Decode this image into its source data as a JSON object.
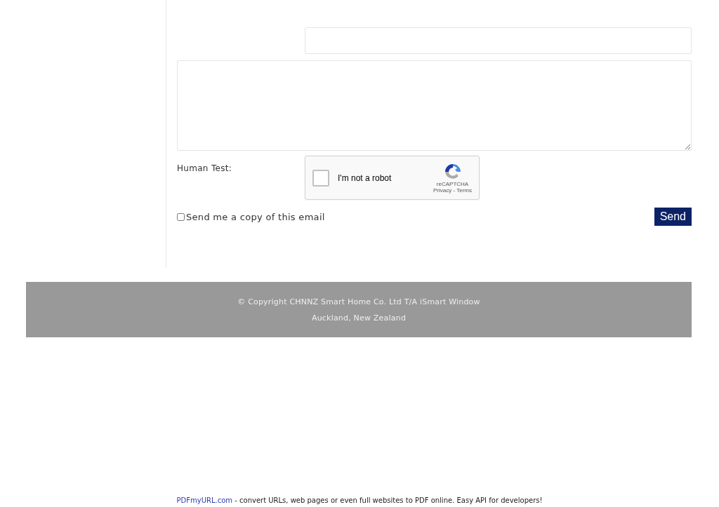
{
  "form": {
    "human_test": {
      "label": "Human Test:",
      "captcha": {
        "checked": false,
        "label": "I'm not a robot",
        "brand": "reCAPTCHA",
        "links": "Privacy - Terms"
      }
    },
    "copy_option": {
      "checked": false,
      "label": "Send me a copy of this email"
    },
    "send_button": "Send"
  },
  "footer": {
    "lines": [
      "© Copyright CHNNZ Smart Home Co. Ltd T/A iSmart Window",
      "Auckland, New Zealand"
    ]
  },
  "pdf_banner": {
    "link": "PDFmyURL.com",
    "text": " - convert URLs, web pages or even full websites to PDF online. Easy API for developers!"
  }
}
